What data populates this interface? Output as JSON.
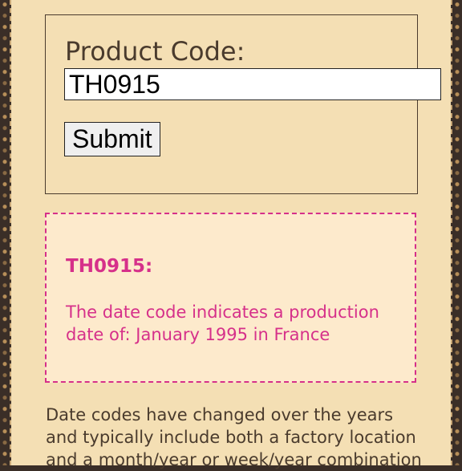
{
  "form": {
    "label": "Product Code:",
    "input_value": "TH0915",
    "submit_label": "Submit"
  },
  "result": {
    "code_heading": "TH0915:",
    "message": "The date code indicates a production date of: January 1995 in France"
  },
  "info": {
    "text": "Date codes have changed over the years and typically include both a factory location and a month/year or week/year combination"
  },
  "colors": {
    "page_background": "#f4dfb4",
    "result_accent": "#d6308a",
    "result_background": "#fdeacc",
    "text": "#4a3b2d"
  }
}
